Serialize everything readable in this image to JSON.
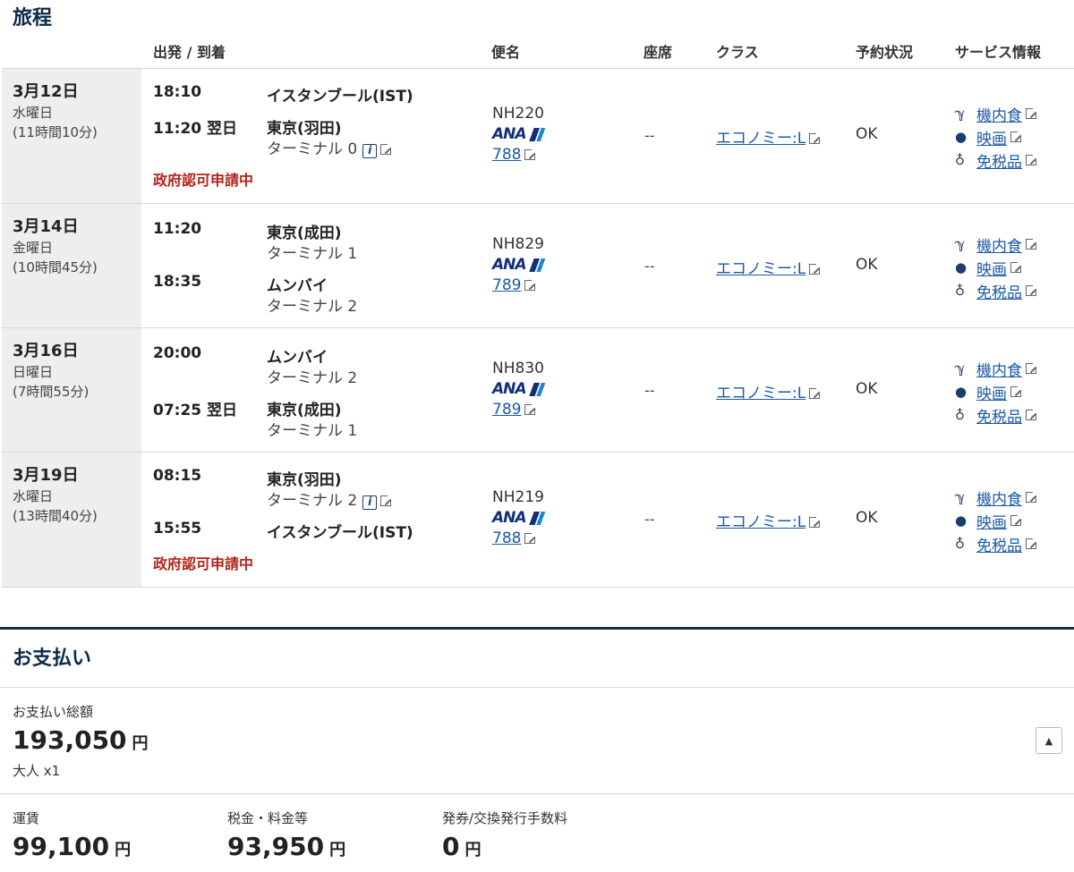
{
  "itinerary": {
    "title": "旅程",
    "headers": {
      "depart_arrive": "出発 / 到着",
      "flight": "便名",
      "seat": "座席",
      "class": "クラス",
      "status": "予約状況",
      "service": "サービス情報"
    },
    "segments": [
      {
        "date": "3月12日",
        "dow": "水曜日",
        "duration": "(11時間10分)",
        "dep_time": "18:10",
        "dep_city": "イスタンブール(IST)",
        "dep_terminal": "",
        "arr_time": "11:20 翌日",
        "arr_city": "東京(羽田)",
        "arr_terminal": "ターミナル 0",
        "note": "政府認可申請中",
        "flight_no": "NH220",
        "airline_logo": "ANA",
        "aircraft": "788",
        "seat": "--",
        "class": "エコノミー:L",
        "status": "OK"
      },
      {
        "date": "3月14日",
        "dow": "金曜日",
        "duration": "(10時間45分)",
        "dep_time": "11:20",
        "dep_city": "東京(成田)",
        "dep_terminal": "ターミナル 1",
        "arr_time": "18:35",
        "arr_city": "ムンバイ",
        "arr_terminal": "ターミナル 2",
        "note": "",
        "flight_no": "NH829",
        "airline_logo": "ANA",
        "aircraft": "789",
        "seat": "--",
        "class": "エコノミー:L",
        "status": "OK"
      },
      {
        "date": "3月16日",
        "dow": "日曜日",
        "duration": "(7時間55分)",
        "dep_time": "20:00",
        "dep_city": "ムンバイ",
        "dep_terminal": "ターミナル 2",
        "arr_time": "07:25 翌日",
        "arr_city": "東京(成田)",
        "arr_terminal": "ターミナル 1",
        "note": "",
        "flight_no": "NH830",
        "airline_logo": "ANA",
        "aircraft": "789",
        "seat": "--",
        "class": "エコノミー:L",
        "status": "OK"
      },
      {
        "date": "3月19日",
        "dow": "水曜日",
        "duration": "(13時間40分)",
        "dep_time": "08:15",
        "dep_city": "東京(羽田)",
        "dep_terminal": "ターミナル 2",
        "arr_time": "15:55",
        "arr_city": "イスタンブール(IST)",
        "arr_terminal": "",
        "note": "政府認可申請中",
        "flight_no": "NH219",
        "airline_logo": "ANA",
        "aircraft": "788",
        "seat": "--",
        "class": "エコノミー:L",
        "status": "OK"
      }
    ],
    "services": {
      "meal": "機内食",
      "movie": "映画",
      "dutyfree": "免税品"
    }
  },
  "payment": {
    "title": "お支払い",
    "total_label": "お支払い総額",
    "total_amount": "193,050",
    "currency": "円",
    "passengers": "大人 x1",
    "fare_label": "運賃",
    "fare_amount": "99,100",
    "tax_label": "税金・料金等",
    "tax_amount": "93,950",
    "fee_label": "発券/交換発行手数料",
    "fee_amount": "0"
  },
  "icons": {
    "meal": "fork-knife-icon",
    "movie": "camera-icon",
    "dutyfree": "bottle-watch-icon",
    "external": "external-link-icon",
    "info": "info-icon",
    "collapse": "chevron-up-icon"
  },
  "colors": {
    "header_navy": "#0b2a4a",
    "link": "#1a5aa6",
    "alert_red": "#b3241a",
    "date_bg": "#eeeeee",
    "ana_navy": "#12307a",
    "ana_blue": "#1f86d6"
  }
}
